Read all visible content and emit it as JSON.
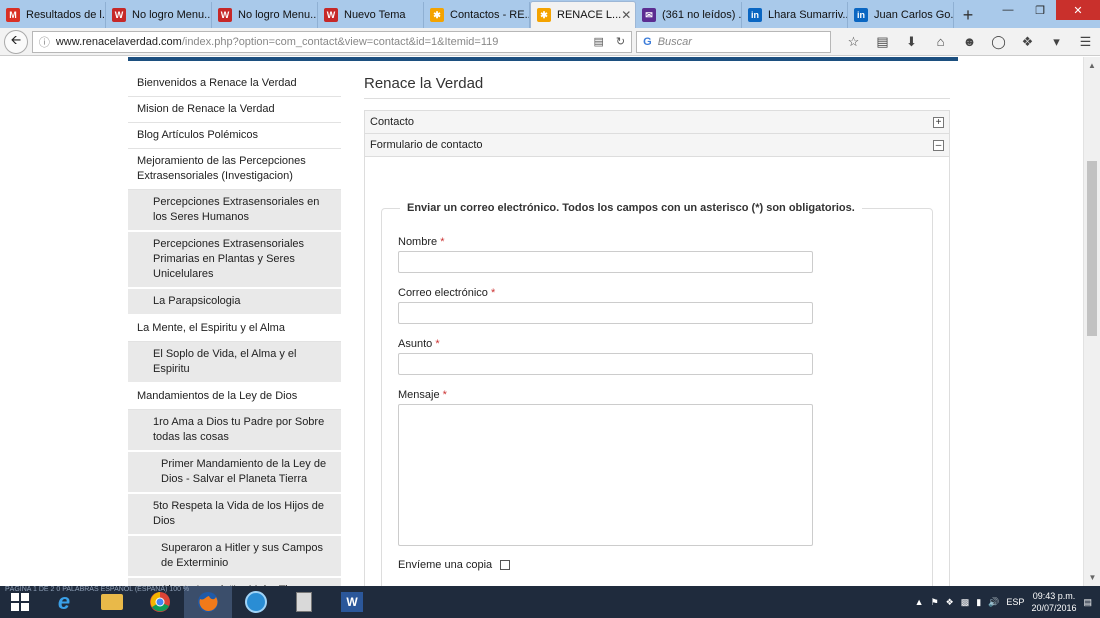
{
  "browser": {
    "tabs": [
      {
        "label": "Resultados de l...",
        "icon": "gmail-icon",
        "color": "#d93025",
        "glyph": "M"
      },
      {
        "label": "No logro Menu...",
        "icon": "forum-icon",
        "color": "#c62828",
        "glyph": "W"
      },
      {
        "label": "No logro Menu...",
        "icon": "forum-icon",
        "color": "#c62828",
        "glyph": "W"
      },
      {
        "label": "Nuevo Tema",
        "icon": "forum-icon",
        "color": "#c62828",
        "glyph": "W"
      },
      {
        "label": "Contactos - RE...",
        "icon": "joomla-icon",
        "color": "#f4a300",
        "glyph": "✱"
      },
      {
        "label": "RENACE L...",
        "icon": "joomla-icon",
        "color": "#f4a300",
        "glyph": "✱"
      },
      {
        "label": "(361 no leídos) ...",
        "icon": "mail-icon",
        "color": "#5c2d91",
        "glyph": "✉"
      },
      {
        "label": "Lhara Sumarriv...",
        "icon": "linkedin-icon",
        "color": "#0a66c2",
        "glyph": "in"
      },
      {
        "label": "Juan Carlos Go...",
        "icon": "linkedin-icon",
        "color": "#0a66c2",
        "glyph": "in"
      }
    ],
    "url_host": "www.renacelaverdad.com",
    "url_path": "/index.php?option=com_contact&view=contact&id=1&Itemid=119",
    "search_placeholder": "Buscar"
  },
  "sidebar": {
    "items": [
      {
        "label": "Bienvenidos a Renace la Verdad",
        "level": 0
      },
      {
        "label": "Mision de Renace la Verdad",
        "level": 0
      },
      {
        "label": "Blog Artículos Polémicos",
        "level": 0
      },
      {
        "label": "Mejoramiento de las Percepciones Extrasensoriales (Investigacion)",
        "level": 0
      },
      {
        "label": "Percepciones Extrasensoriales en los Seres Humanos",
        "level": 1
      },
      {
        "label": "Percepciones Extrasensoriales Primarias en Plantas y Seres Unicelulares",
        "level": 1
      },
      {
        "label": "La Parapsicologia",
        "level": 1
      },
      {
        "label": "La Mente, el Espiritu y el Alma",
        "level": 0
      },
      {
        "label": "El Soplo de Vida, el Alma y el Espiritu",
        "level": 1
      },
      {
        "label": "Mandamientos de la Ley de Dios",
        "level": 0
      },
      {
        "label": "1ro Ama a Dios tu Padre por Sobre todas las cosas",
        "level": 1
      },
      {
        "label": "Primer Mandamiento de la Ley de Dios - Salvar el Planeta Tierra",
        "level": 2
      },
      {
        "label": "5to Respeta la Vida de los Hijos de Dios",
        "level": 1
      },
      {
        "label": "Superaron a Hitler y sus Campos de Exterminio",
        "level": 2
      },
      {
        "label": "Aborto Legal: “La Mujer Tiene Derecho a Hacer con su Cuerpo lo que Quiera”",
        "level": 2
      }
    ]
  },
  "main": {
    "title": "Renace la Verdad",
    "accordion": {
      "contact_label": "Contacto",
      "form_label": "Formulario de contacto"
    },
    "form": {
      "legend": "Enviar un correo electrónico. Todos los campos con un asterisco (*) son obligatorios.",
      "required_mark": "*",
      "name_label": "Nombre",
      "email_label": "Correo electrónico",
      "subject_label": "Asunto",
      "message_label": "Mensaje",
      "copy_label": "Envíeme una copia"
    }
  },
  "taskbar": {
    "word_status": "PÁGINA 1 DE 2     0 PALABRAS          ESPAÑOL (ESPAÑA)                                                                     100 %",
    "language": "ESP",
    "time": "09:43 p.m.",
    "date": "20/07/2016"
  }
}
